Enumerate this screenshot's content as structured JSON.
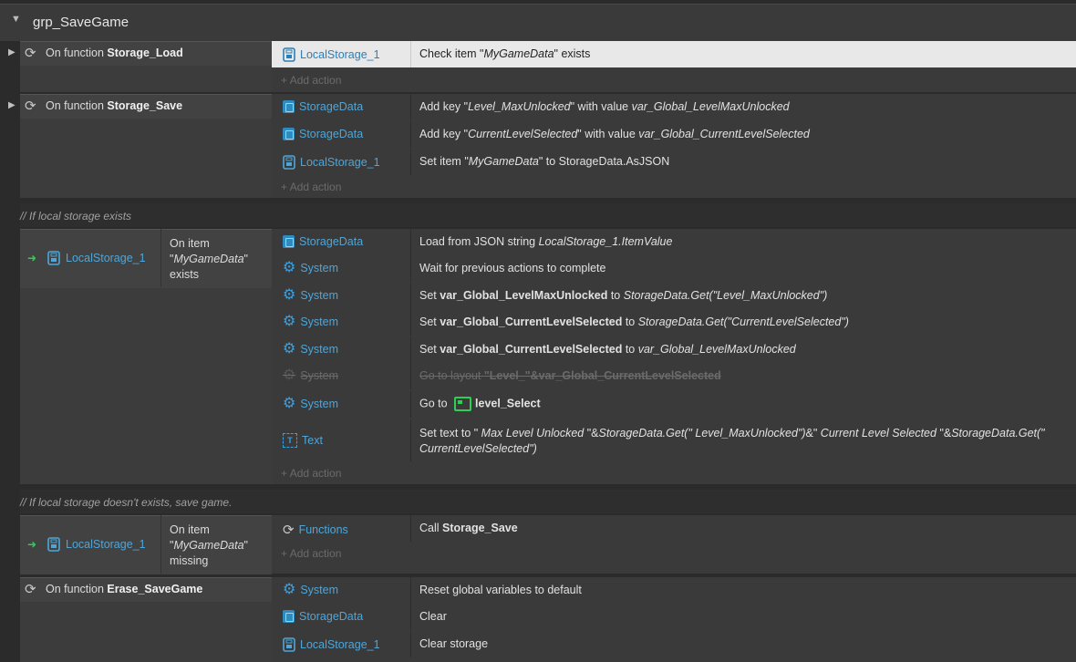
{
  "group": {
    "name": "grp_SaveGame"
  },
  "events": {
    "load": {
      "prefix": "On function ",
      "name": "Storage_Load",
      "actions": [
        {
          "object": "LocalStorage_1",
          "text": "Check item \"MyGameData\" exists"
        }
      ],
      "add_label": "Add action"
    },
    "save": {
      "prefix": "On function ",
      "name": "Storage_Save",
      "actions": [
        {
          "object": "StorageData",
          "text": "Add key \"Level_MaxUnlocked\" with value var_Global_LevelMaxUnlocked"
        },
        {
          "object": "StorageData",
          "text": "Add key \"CurrentLevelSelected\" with value var_Global_CurrentLevelSelected"
        },
        {
          "object": "LocalStorage_1",
          "text": "Set item \"MyGameData\" to StorageData.AsJSON"
        }
      ],
      "add_label": "Add action"
    },
    "comment1": "// If local storage exists",
    "exists": {
      "object": "LocalStorage_1",
      "condition": "On item \"MyGameData\" exists",
      "actions": [
        {
          "object": "StorageData",
          "text": "Load from JSON string LocalStorage_1.ItemValue"
        },
        {
          "object": "System",
          "text": "Wait for previous actions to complete"
        },
        {
          "object": "System",
          "text": "Set var_Global_LevelMaxUnlocked to StorageData.Get(\"Level_MaxUnlocked\")"
        },
        {
          "object": "System",
          "text": "Set var_Global_CurrentLevelSelected to StorageData.Get(\"CurrentLevelSelected\")"
        },
        {
          "object": "System",
          "text": "Set var_Global_CurrentLevelSelected to var_Global_LevelMaxUnlocked"
        },
        {
          "object": "System",
          "text": "Go to layout \"Level_\"&var_Global_CurrentLevelSelected",
          "disabled": true
        },
        {
          "object": "System",
          "text": "Go to level_Select"
        },
        {
          "object": "Text",
          "text": "Set text to \" Max Level Unlocked \"&StorageData.Get(\" Level_MaxUnlocked\")&\" Current Level Selected \"&StorageData.Get(\" CurrentLevelSelected\")"
        }
      ],
      "add_label": "Add action"
    },
    "comment2": "// If local storage doesn't exists, save game.",
    "missing": {
      "object": "LocalStorage_1",
      "condition": "On item \"MyGameData\" missing",
      "actions": [
        {
          "object": "Functions",
          "text": "Call Storage_Save"
        }
      ],
      "add_label": "Add action"
    },
    "erase": {
      "prefix": "On function ",
      "name": "Erase_SaveGame",
      "actions": [
        {
          "object": "System",
          "text": "Reset global variables to default"
        },
        {
          "object": "StorageData",
          "text": "Clear"
        },
        {
          "object": "LocalStorage_1",
          "text": "Clear storage"
        }
      ]
    }
  },
  "colors": {
    "object_link": "#4ea6d8",
    "selected_row": "#e8e8e8",
    "layout_icon": "#2fcf57"
  }
}
